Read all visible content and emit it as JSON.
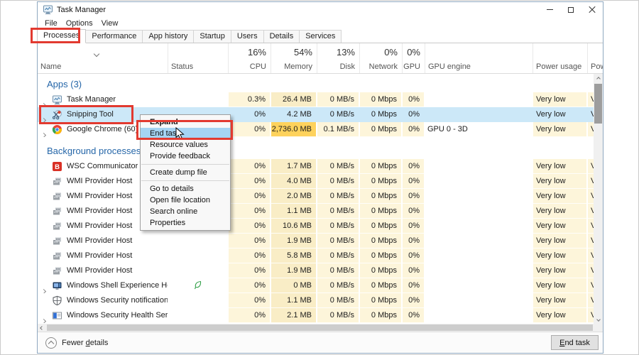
{
  "window": {
    "title": "Task Manager"
  },
  "menubar": {
    "items": [
      "File",
      "Options",
      "View"
    ]
  },
  "tabs": [
    "Processes",
    "Performance",
    "App history",
    "Startup",
    "Users",
    "Details",
    "Services"
  ],
  "header": {
    "name": "Name",
    "status": "Status",
    "metrics": [
      {
        "key": "cpu",
        "pct": "16%",
        "label": "CPU"
      },
      {
        "key": "memory",
        "pct": "54%",
        "label": "Memory"
      },
      {
        "key": "disk",
        "pct": "13%",
        "label": "Disk"
      },
      {
        "key": "network",
        "pct": "0%",
        "label": "Network"
      },
      {
        "key": "gpu",
        "pct": "0%",
        "label": "GPU"
      }
    ],
    "gpu_engine": "GPU engine",
    "power_usage": "Power usage",
    "power_trend": "Pow"
  },
  "body": [
    {
      "type": "section",
      "label": "Apps (3)"
    },
    {
      "type": "row",
      "icon": "task-manager",
      "chevron": true,
      "name": "Task Manager",
      "cpu": "0.3%",
      "memory": "26.4 MB",
      "disk": "0 MB/s",
      "network": "0 Mbps",
      "gpu": "0%",
      "gpu_engine": "",
      "power": "Very low",
      "trend": "V"
    },
    {
      "type": "row",
      "icon": "snipping-tool",
      "chevron": true,
      "selected": true,
      "name": "Snipping Tool",
      "cpu": "0%",
      "memory": "4.2 MB",
      "disk": "0 MB/s",
      "network": "0 Mbps",
      "gpu": "0%",
      "gpu_engine": "",
      "power": "Very low",
      "trend": "V"
    },
    {
      "type": "row",
      "icon": "chrome",
      "chevron": true,
      "name": "Google Chrome (60)",
      "cpu": "0%",
      "memory": "2,736.0 MB",
      "mem_hot": true,
      "disk": "0.1 MB/s",
      "network": "0 Mbps",
      "gpu": "0%",
      "gpu_engine": "GPU 0 - 3D",
      "power": "Very low",
      "trend": "V"
    },
    {
      "type": "section",
      "label": "Background processes ("
    },
    {
      "type": "row",
      "icon": "wsc",
      "name": "WSC Communicator",
      "cpu": "0%",
      "memory": "1.7 MB",
      "disk": "0 MB/s",
      "network": "0 Mbps",
      "gpu": "0%",
      "gpu_engine": "",
      "power": "Very low",
      "trend": "V"
    },
    {
      "type": "row",
      "icon": "wmi",
      "name": "WMI Provider Host",
      "cpu": "0%",
      "memory": "4.0 MB",
      "disk": "0 MB/s",
      "network": "0 Mbps",
      "gpu": "0%",
      "gpu_engine": "",
      "power": "Very low",
      "trend": "V"
    },
    {
      "type": "row",
      "icon": "wmi",
      "name": "WMI Provider Host",
      "cpu": "0%",
      "memory": "2.0 MB",
      "disk": "0 MB/s",
      "network": "0 Mbps",
      "gpu": "0%",
      "gpu_engine": "",
      "power": "Very low",
      "trend": "V"
    },
    {
      "type": "row",
      "icon": "wmi",
      "name": "WMI Provider Host",
      "cpu": "0%",
      "memory": "1.1 MB",
      "disk": "0 MB/s",
      "network": "0 Mbps",
      "gpu": "0%",
      "gpu_engine": "",
      "power": "Very low",
      "trend": "V"
    },
    {
      "type": "row",
      "icon": "wmi",
      "name": "WMI Provider Host",
      "cpu": "0%",
      "memory": "10.6 MB",
      "disk": "0 MB/s",
      "network": "0 Mbps",
      "gpu": "0%",
      "gpu_engine": "",
      "power": "Very low",
      "trend": "V"
    },
    {
      "type": "row",
      "icon": "wmi",
      "name": "WMI Provider Host",
      "cpu": "0%",
      "memory": "1.9 MB",
      "disk": "0 MB/s",
      "network": "0 Mbps",
      "gpu": "0%",
      "gpu_engine": "",
      "power": "Very low",
      "trend": "V"
    },
    {
      "type": "row",
      "icon": "wmi",
      "name": "WMI Provider Host",
      "cpu": "0%",
      "memory": "5.8 MB",
      "disk": "0 MB/s",
      "network": "0 Mbps",
      "gpu": "0%",
      "gpu_engine": "",
      "power": "Very low",
      "trend": "V"
    },
    {
      "type": "row",
      "icon": "wmi",
      "name": "WMI Provider Host",
      "cpu": "0%",
      "memory": "1.9 MB",
      "disk": "0 MB/s",
      "network": "0 Mbps",
      "gpu": "0%",
      "gpu_engine": "",
      "power": "Very low",
      "trend": "V"
    },
    {
      "type": "row",
      "icon": "shell",
      "chevron": true,
      "leaf": true,
      "name": "Windows Shell Experience Host",
      "cpu": "0%",
      "memory": "0 MB",
      "disk": "0 MB/s",
      "network": "0 Mbps",
      "gpu": "0%",
      "gpu_engine": "",
      "power": "Very low",
      "trend": "V"
    },
    {
      "type": "row",
      "icon": "shield",
      "name": "Windows Security notification i...",
      "cpu": "0%",
      "memory": "1.1 MB",
      "disk": "0 MB/s",
      "network": "0 Mbps",
      "gpu": "0%",
      "gpu_engine": "",
      "power": "Very low",
      "trend": "V"
    },
    {
      "type": "row",
      "icon": "health",
      "chevron": true,
      "name": "Windows Security Health Service",
      "cpu": "0%",
      "memory": "2.1 MB",
      "disk": "0 MB/s",
      "network": "0 Mbps",
      "gpu": "0%",
      "gpu_engine": "",
      "power": "Very low",
      "trend": "V"
    }
  ],
  "context_menu": {
    "items": [
      {
        "label": "Expand",
        "bold": true
      },
      {
        "label": "End task",
        "highlighted": true
      },
      {
        "label": "Resource values",
        "submenu": true
      },
      {
        "label": "Provide feedback"
      },
      {
        "type": "separator"
      },
      {
        "label": "Create dump file"
      },
      {
        "type": "separator"
      },
      {
        "label": "Go to details"
      },
      {
        "label": "Open file location"
      },
      {
        "label": "Search online"
      },
      {
        "label": "Properties"
      }
    ]
  },
  "footer": {
    "fewer_details": {
      "prefix": "Fewer ",
      "accel": "d",
      "suffix": "etails"
    },
    "end_task": {
      "accel": "E",
      "suffix": "nd task"
    }
  },
  "colors": {
    "annotation_red": "#e23a30",
    "selection_blue": "#cce8f8",
    "menu_highlight_blue": "#a5d4f3",
    "heat_light": "#fdf5da",
    "heat_memory": "#f9edc6",
    "heat_hot": "#fed25c",
    "section_blue": "#2566a8"
  }
}
